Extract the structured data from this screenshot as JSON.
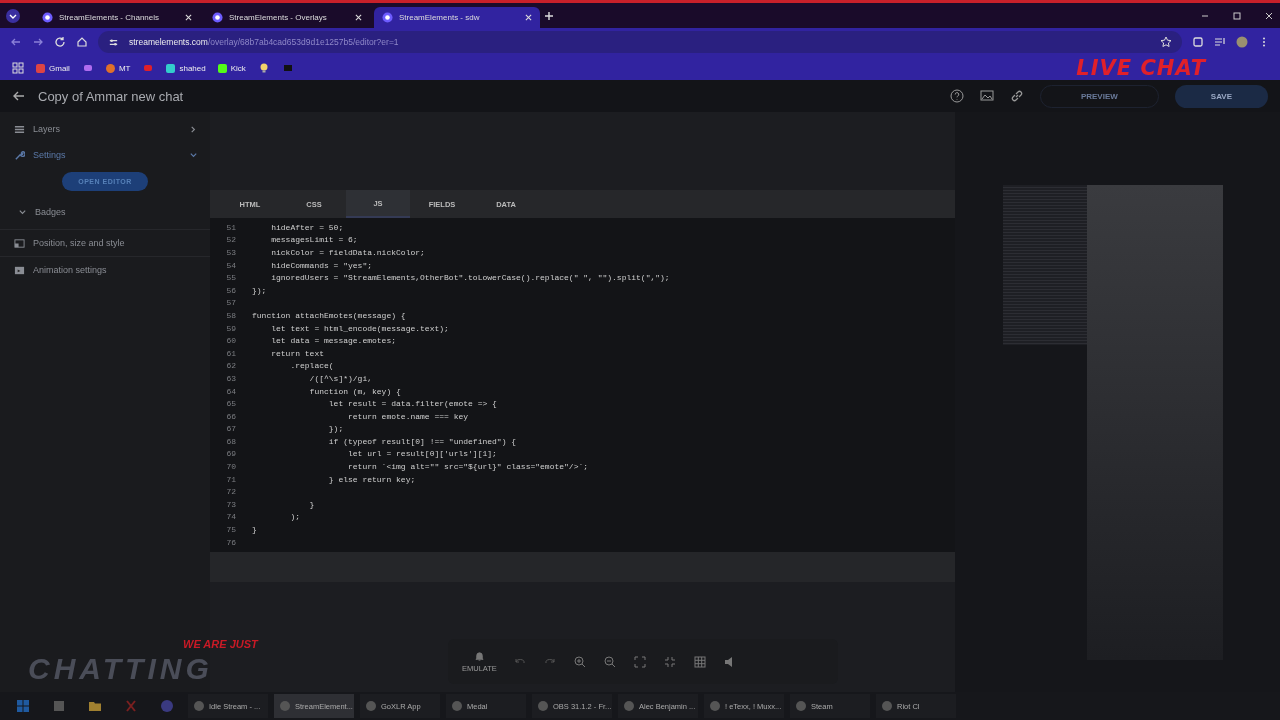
{
  "browser": {
    "tabs": [
      {
        "title": "StreamElements - Channels",
        "selected": false
      },
      {
        "title": "StreamElements - Overlays",
        "selected": false
      },
      {
        "title": "StreamElements - sdw",
        "selected": true
      }
    ],
    "url_host": "streamelements.com",
    "url_path": "/overlay/68b7ab4cad653d9d1e1257b5/editor?er=1",
    "bookmarks": [
      "Gmail",
      "MT",
      "shahed",
      "Kick"
    ]
  },
  "header": {
    "title": "Copy of Ammar new chat",
    "preview_button": "PREVIEW",
    "save_button": "SAVE"
  },
  "overlay_texts": {
    "live_chat": "LIVE CHAT",
    "we_are_just": "WE ARE JUST",
    "chatting": "CHATTING"
  },
  "sidebar": {
    "items": [
      {
        "label": "Layers",
        "kind": "section",
        "expanded": false,
        "active": false
      },
      {
        "label": "Settings",
        "kind": "section",
        "expanded": true,
        "active": true
      },
      {
        "label": "OPEN EDITOR",
        "kind": "button"
      },
      {
        "label": "Badges",
        "kind": "group",
        "expanded": false
      },
      {
        "label": "Position, size and style",
        "kind": "panel"
      },
      {
        "label": "Animation settings",
        "kind": "animation"
      }
    ]
  },
  "editor": {
    "tabs": [
      {
        "label": "HTML",
        "selected": false
      },
      {
        "label": "CSS",
        "selected": false
      },
      {
        "label": "JS",
        "selected": true
      },
      {
        "label": "FIELDS",
        "selected": false
      },
      {
        "label": "DATA",
        "selected": false
      }
    ],
    "lines": [
      {
        "n": "51",
        "code": "    hideAfter = 50;"
      },
      {
        "n": "52",
        "code": "    messagesLimit = 6;"
      },
      {
        "n": "53",
        "code": "    nickColor = fieldData.nickColor;"
      },
      {
        "n": "54",
        "code": "    hideCommands = \"yes\";"
      },
      {
        "n": "55",
        "code": "    ignoredUsers = \"StreamElements,OtherBot\".toLowerCase().replace(\" \", \"\").split(\",\");"
      },
      {
        "n": "56",
        "code": "});"
      },
      {
        "n": "57"
      },
      {
        "n": "58",
        "code": "function attachEmotes(message) {"
      },
      {
        "n": "59",
        "code": "    let text = html_encode(message.text);"
      },
      {
        "n": "60",
        "code": "    let data = message.emotes;"
      },
      {
        "n": "61",
        "code": "    return text"
      },
      {
        "n": "62",
        "code": "        .replace("
      },
      {
        "n": "63",
        "code": "            /([^\\s]*)/gi,"
      },
      {
        "n": "64",
        "code": "            function (m, key) {"
      },
      {
        "n": "65",
        "code": "                let result = data.filter(emote => {"
      },
      {
        "n": "66",
        "code": "                    return emote.name === key"
      },
      {
        "n": "67",
        "code": "                });"
      },
      {
        "n": "68",
        "code": "                if (typeof result[0] !== \"undefined\") {"
      },
      {
        "n": "69",
        "code": "                    let url = result[0]['urls'][1];"
      },
      {
        "n": "70",
        "code": "                    return `<img alt=\"\" src=\"${url}\" class=\"emote\"/>`;"
      },
      {
        "n": "71",
        "code": "                } else return key;"
      },
      {
        "n": "72"
      },
      {
        "n": "73",
        "code": "            }"
      },
      {
        "n": "74",
        "code": "        );"
      },
      {
        "n": "75",
        "code": "}"
      },
      {
        "n": "76"
      }
    ]
  },
  "toolbar": {
    "emulate": "EMULATE"
  },
  "taskbar": {
    "apps": [
      {
        "label": "Idle Stream - ...",
        "selected": false
      },
      {
        "label": "StreamElement...",
        "selected": true
      },
      {
        "label": "GoXLR App",
        "selected": false
      },
      {
        "label": "Medal",
        "selected": false
      },
      {
        "label": "OBS 31.1.2 - Fr...",
        "selected": false
      },
      {
        "label": "Alec Benjamin ...",
        "selected": false
      },
      {
        "label": "! eTexx, ! Muxx...",
        "selected": false
      },
      {
        "label": "Steam",
        "selected": false
      },
      {
        "label": "Riot Cl",
        "selected": false
      }
    ]
  }
}
